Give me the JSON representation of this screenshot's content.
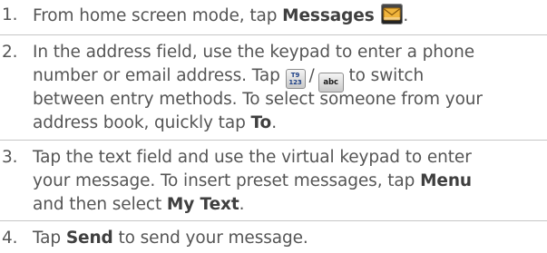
{
  "steps": [
    {
      "number": "1.",
      "lines": [
        {
          "before": "From home screen mode, tap ",
          "bold": "Messages",
          "icon": "messages-envelope-icon"
        }
      ]
    },
    {
      "number": "2.",
      "lines": [
        {
          "text": "In the address field, use the keypad to enter a phone"
        },
        {
          "before": "number or email address. Tap ",
          "key_t9_top": "T9",
          "key_t9_bottom": "123",
          "slash": "/",
          "key_abc": "abc",
          "after": " to switch"
        },
        {
          "text": "between entry methods. To select someone from your"
        },
        {
          "before": "address book, quickly tap ",
          "bold": "To",
          "after": "."
        }
      ]
    },
    {
      "number": "3.",
      "lines": [
        {
          "text": "Tap the text field and use the virtual keypad to enter"
        },
        {
          "before": "your message. To insert preset messages, tap ",
          "bold": "Menu"
        },
        {
          "before": "and then select ",
          "bold": "My Text",
          "after": "."
        }
      ]
    },
    {
      "number": "4.",
      "lines": [
        {
          "before": "Tap ",
          "bold": "Send",
          "after": " to send your message."
        }
      ]
    }
  ],
  "colors": {
    "text": "#555555",
    "bold_text": "#3f3f3f",
    "separator": "#c6c6c6",
    "icon_envelope": "#f0b43c",
    "key_text": "#1c3f86"
  }
}
